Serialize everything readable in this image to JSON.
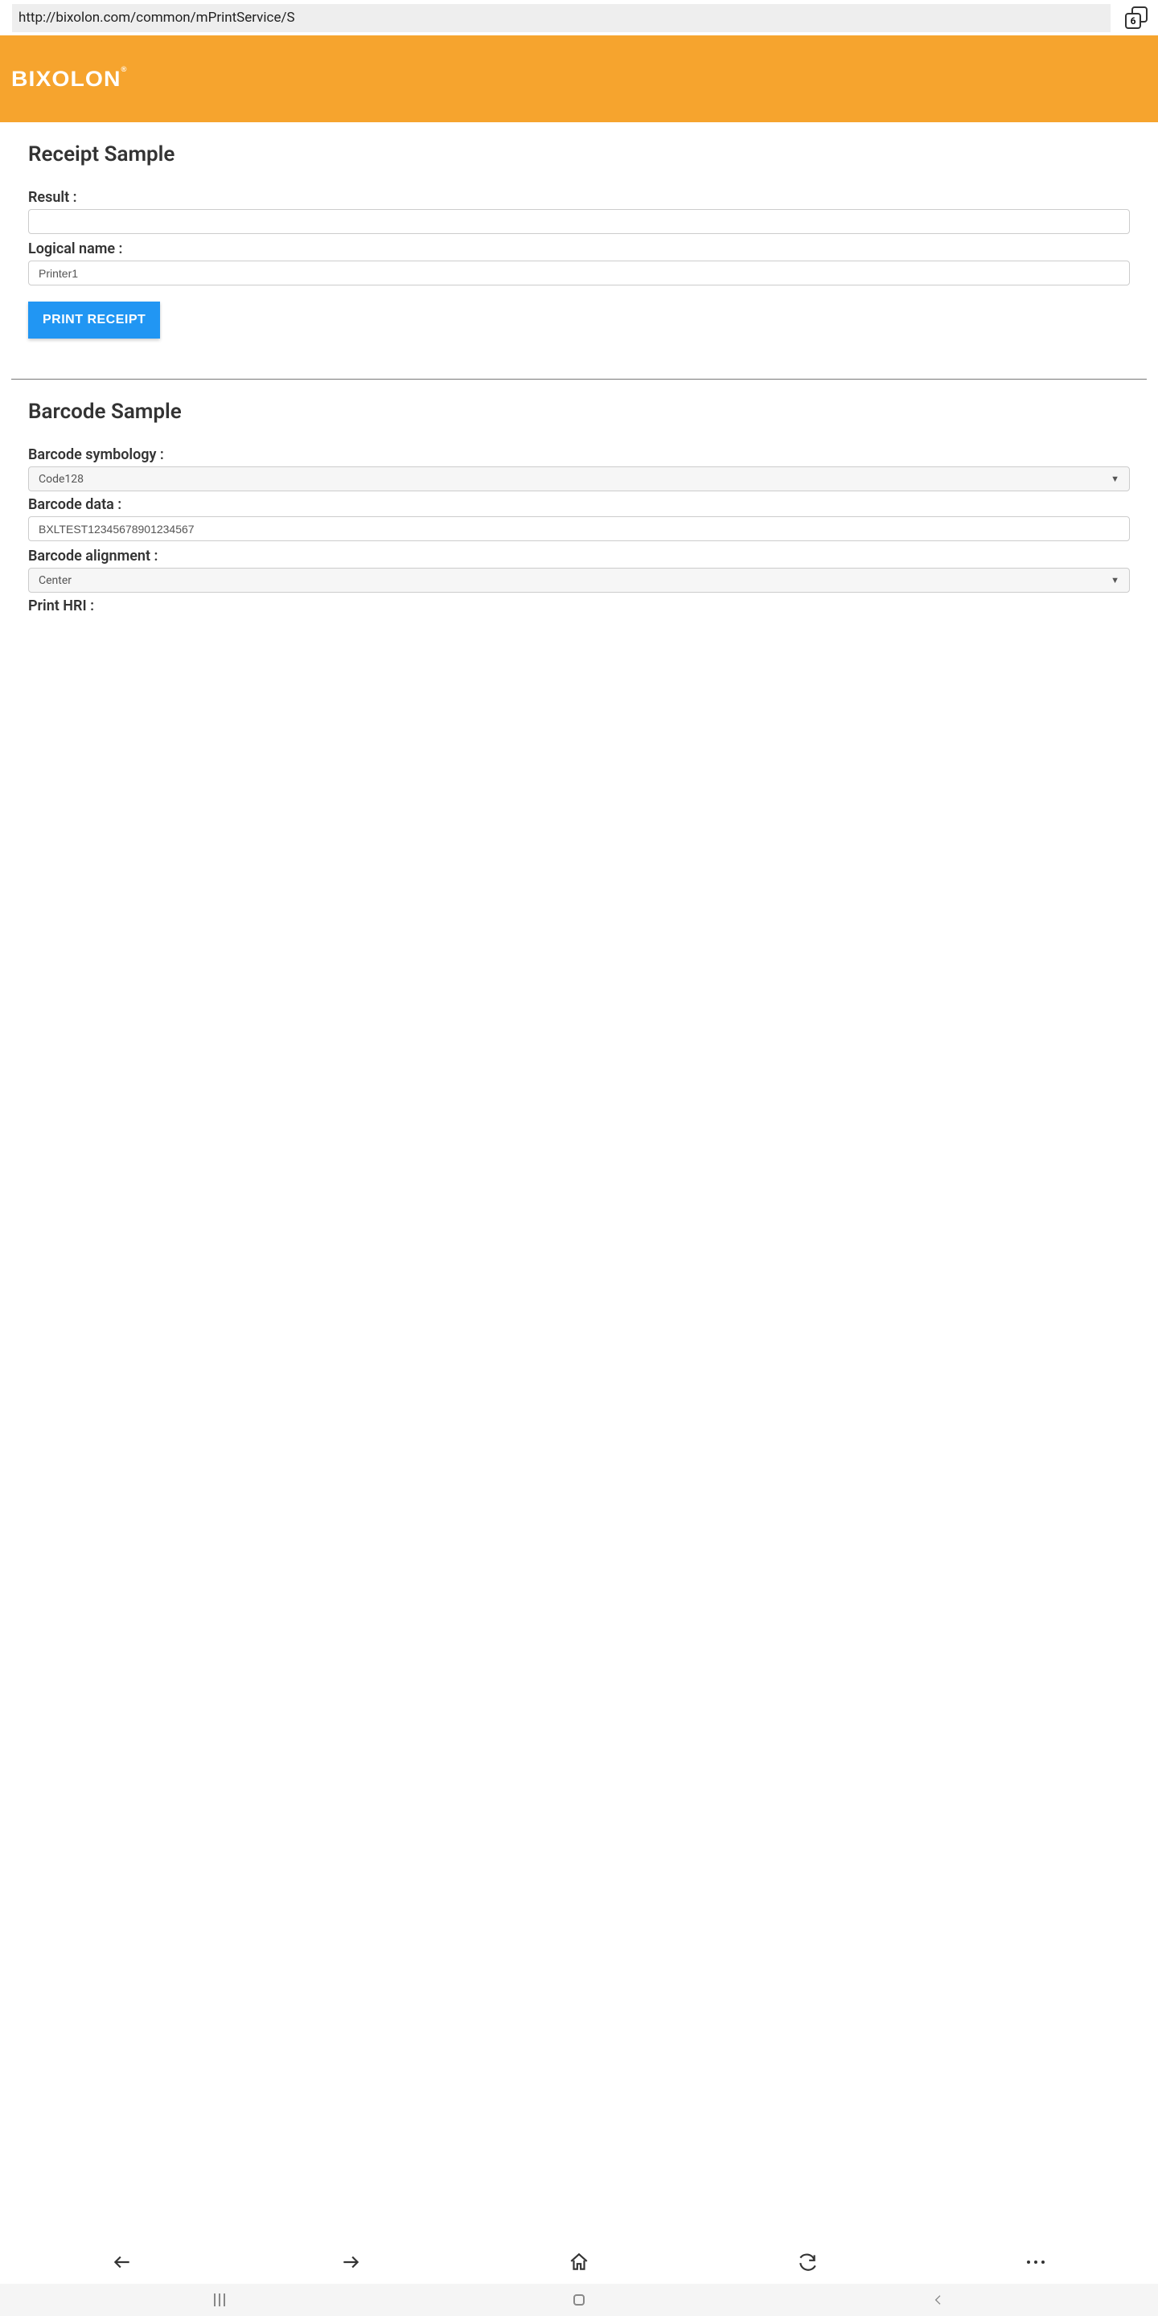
{
  "browser": {
    "url": "http://bixolon.com/common/mPrintService/S",
    "tab_count": "6"
  },
  "header": {
    "logo_text": "BIXOLON",
    "logo_reg": "®"
  },
  "receipt_section": {
    "title": "Receipt Sample",
    "result_label": "Result :",
    "result_value": "",
    "logical_name_label": "Logical name :",
    "logical_name_value": "Printer1",
    "print_button": "PRINT RECEIPT"
  },
  "barcode_section": {
    "title": "Barcode Sample",
    "symbology_label": "Barcode symbology :",
    "symbology_value": "Code128",
    "data_label": "Barcode data :",
    "data_value": "BXLTEST12345678901234567",
    "alignment_label": "Barcode alignment :",
    "alignment_value": "Center",
    "hri_label": "Print HRI :"
  }
}
